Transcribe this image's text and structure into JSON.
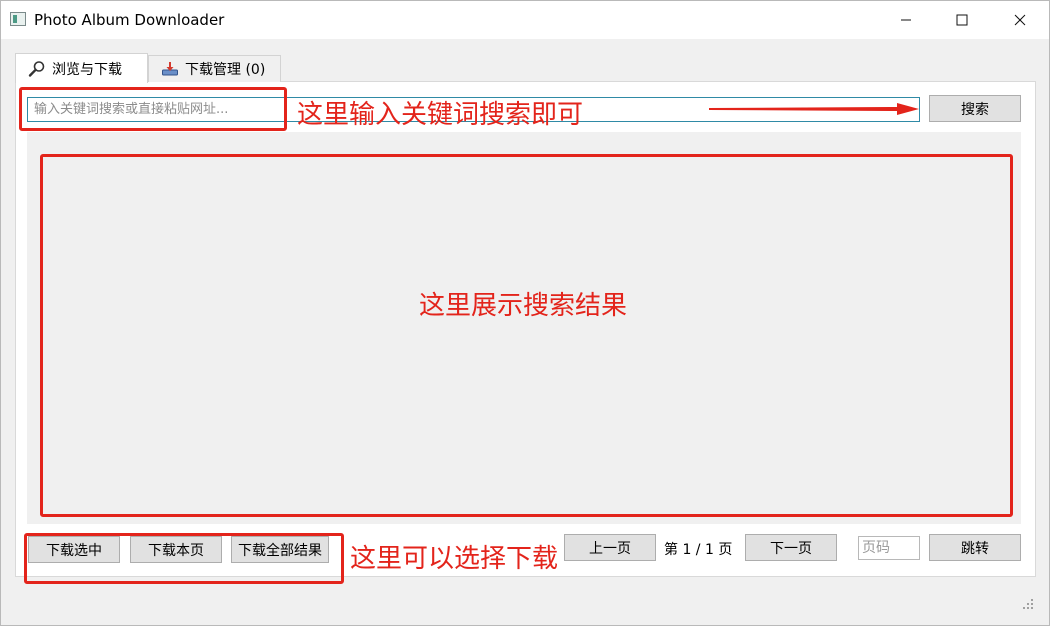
{
  "window": {
    "title": "Photo Album Downloader"
  },
  "tabs": [
    {
      "label": "浏览与下载",
      "icon": "search-icon",
      "active": true
    },
    {
      "label": "下载管理 (0)",
      "icon": "download-tray-icon",
      "active": false
    }
  ],
  "search": {
    "placeholder": "输入关键词搜索或直接粘贴网址...",
    "value": "",
    "button_label": "搜索"
  },
  "actions": {
    "download_selected": "下载选中",
    "download_page": "下载本页",
    "download_all": "下载全部结果"
  },
  "pagination": {
    "prev_label": "上一页",
    "info": "第 1 / 1 页",
    "next_label": "下一页",
    "page_input_placeholder": "页码",
    "jump_label": "跳转"
  },
  "annotations": {
    "search_hint": "这里输入关键词搜索即可",
    "results_hint": "这里展示搜索结果",
    "download_hint": "这里可以选择下载"
  },
  "colors": {
    "annotation": "#e3241b",
    "input_focus_border": "#2f8aa6"
  }
}
